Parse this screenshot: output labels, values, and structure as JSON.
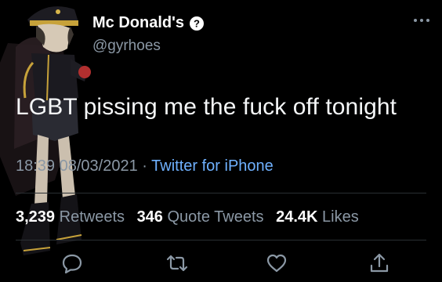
{
  "tweet": {
    "author_name": "Mc Donald's",
    "handle": "@gyrhoes",
    "text": "LGBT pissing me the fuck off tonight",
    "time": "18:39",
    "date": "08/03/2021",
    "separator": "·",
    "source": "Twitter for iPhone"
  },
  "stats": {
    "retweets_count": "3,239",
    "retweets_label": "Retweets",
    "quote_count": "346",
    "quote_label": "Quote Tweets",
    "likes_count": "24.4K",
    "likes_label": "Likes"
  },
  "icons": {
    "verified": "verified-badge-icon",
    "more": "more-dots-icon",
    "reply": "reply-icon",
    "retweet": "retweet-icon",
    "like": "heart-icon",
    "share": "share-icon"
  },
  "colors": {
    "background": "#000000",
    "text": "#e7e9ea",
    "muted": "#8b98a5",
    "link": "#6fb1ff"
  }
}
